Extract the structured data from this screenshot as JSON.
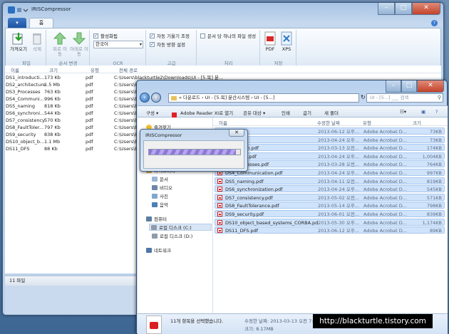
{
  "main_window": {
    "title": "IRISCompressor",
    "tabs": {
      "file": "",
      "home": "홈"
    },
    "ribbon": {
      "file_group": {
        "label": "파일",
        "add": "가져오기",
        "delete": "삭제"
      },
      "order_group": {
        "label": "순서 변경",
        "up": "위로 이동",
        "down": "아래로 이동"
      },
      "ocr_group": {
        "label": "OCR",
        "enable": "활성화됨",
        "language": "한국어"
      },
      "advanced_group": {
        "label": "고급",
        "auto_rotate": "자동 기울기 조정",
        "auto_orient": "자동 방향 설정"
      },
      "process_group": {
        "label": "처리",
        "single_file": "문서 당 하나의 파일 생성"
      },
      "save_group": {
        "label": "저장",
        "pdf": "PDF",
        "xps": "XPS"
      }
    },
    "columns": [
      "이름",
      "크기",
      "유형",
      "전체 경로"
    ],
    "files": [
      {
        "name": "DS1_introducti...",
        "size": "173 Kb",
        "type": "pdf",
        "path": "C:\\Users\\blackturtle2\\Downloads\\UI - [5.목] 분..."
      },
      {
        "name": "DS2_architecture",
        "size": "1.5 Mb",
        "type": "pdf",
        "path": "C:\\Users\\bla"
      },
      {
        "name": "DS3_Processes",
        "size": "763 Kb",
        "type": "pdf",
        "path": "C:\\Users\\bla"
      },
      {
        "name": "DS4_Communi...",
        "size": "996 Kb",
        "type": "pdf",
        "path": "C:\\Users\\bla"
      },
      {
        "name": "DS5_naming",
        "size": "818 Kb",
        "type": "pdf",
        "path": "C:\\Users\\bla"
      },
      {
        "name": "DS6_synchroni...",
        "size": "544 Kb",
        "type": "pdf",
        "path": "C:\\Users\\bla"
      },
      {
        "name": "DS7_consistency",
        "size": "570 Kb",
        "type": "pdf",
        "path": "C:\\Users\\bla"
      },
      {
        "name": "DS8_FaultToler...",
        "size": "797 Kb",
        "type": "pdf",
        "path": "C:\\Users\\bla"
      },
      {
        "name": "DS9_security",
        "size": "838 Kb",
        "type": "pdf",
        "path": "C:\\Users\\bla"
      },
      {
        "name": "DS10_object_b...",
        "size": "1.1 Mb",
        "type": "pdf",
        "path": "C:\\Users\\bla"
      },
      {
        "name": "DS11_DFS",
        "size": "88 Kb",
        "type": "pdf",
        "path": "C:\\Users\\bla"
      }
    ],
    "status": "11 파일"
  },
  "explorer": {
    "address": "« 다운로드 › UI - [5.목] 분산시스템 › UI - [5...] ",
    "search_placeholder": "UI - [5...] ___ 검색",
    "commands": [
      "구성 ▾",
      "Adobe Reader XI로 열기",
      "공유 대상 ▾",
      "인쇄",
      "굽기",
      "새 폴더"
    ],
    "columns": [
      "이름",
      "수정한 날짜",
      "유형",
      "크기"
    ],
    "nav": {
      "favorites": "즐겨찾기",
      "libraries": "라이브러리",
      "documents": "문서",
      "videos": "비디오",
      "pictures": "사진",
      "music": "음악",
      "computer": "컴퓨터",
      "local_c": "로컬 디스크 (C:)",
      "local_d": "로컬 디스크 (D:)",
      "network": "네트워크"
    },
    "files": [
      {
        "name": "....pdf",
        "date": "2013-06-12 오후...",
        "type": "Adobe Acrobat D...",
        "size": "73KB"
      },
      {
        "name": "....pdf",
        "date": "2013-04-24 오후...",
        "type": "Adobe Acrobat D...",
        "size": "73KB"
      },
      {
        "name": "...oduction.pdf",
        "date": "2013-03-13 오전...",
        "type": "Adobe Acrobat D...",
        "size": "174KB"
      },
      {
        "name": "...itecture.pdf",
        "date": "2013-04-24 오후...",
        "type": "Adobe Acrobat D...",
        "size": "1,004KB"
      },
      {
        "name": "DS3_Processes.pdf",
        "date": "2013-03-28 오전...",
        "type": "Adobe Acrobat D...",
        "size": "764KB"
      },
      {
        "name": "DS4_Communication.pdf",
        "date": "2013-04-24 오후...",
        "type": "Adobe Acrobat D...",
        "size": "997KB"
      },
      {
        "name": "DS5_naming.pdf",
        "date": "2013-04-11 오전...",
        "type": "Adobe Acrobat D...",
        "size": "819KB"
      },
      {
        "name": "DS6_synchronization.pdf",
        "date": "2013-04-24 오후...",
        "type": "Adobe Acrobat D...",
        "size": "545KB"
      },
      {
        "name": "DS7_consistency.pdf",
        "date": "2013-05-02 오전...",
        "type": "Adobe Acrobat D...",
        "size": "571KB"
      },
      {
        "name": "DS8_FaultTolerance.pdf",
        "date": "2013-05-14 오후...",
        "type": "Adobe Acrobat D...",
        "size": "798KB"
      },
      {
        "name": "DS9_security.pdf",
        "date": "2013-06-01 오전...",
        "type": "Adobe Acrobat D...",
        "size": "839KB"
      },
      {
        "name": "DS10_object_based_systems_CORBA.pdf",
        "date": "2013-05-30 오후...",
        "type": "Adobe Acrobat D...",
        "size": "1,174KB"
      },
      {
        "name": "DS11_DFS.pdf",
        "date": "2013-06-12 오후...",
        "type": "Adobe Acrobat D...",
        "size": "89KB"
      }
    ],
    "details": {
      "selected": "11개 항목을 선택했습니다.",
      "modified": "수정한 날짜: 2013-03-13 오전 7:38 ~ ...",
      "size": "크기: 8.17MB"
    }
  },
  "dialog": {
    "title": "IRISCompressor",
    "close": "✕",
    "progress": 0.95
  },
  "watermark": "http://blackturtle.tistory.com"
}
